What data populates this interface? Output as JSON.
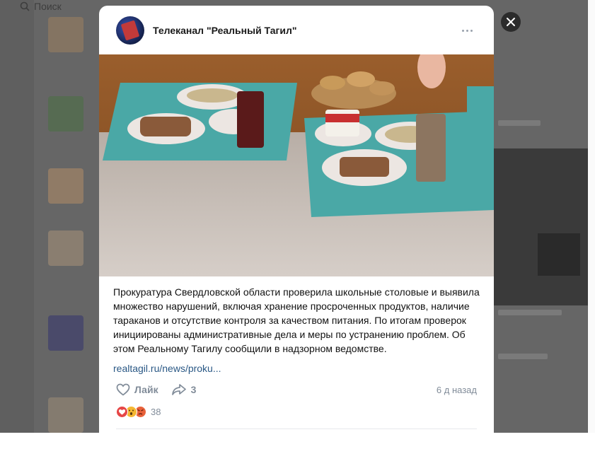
{
  "background": {
    "search_placeholder": "Поиск"
  },
  "post": {
    "channel_name": "Телеканал \"Реальный Тагил\"",
    "text": "Прокуратура Свердловской области проверила школьные столовые и выявила множество нарушений, включая хранение просроченных продуктов, наличие тараканов и отсутствие контроля за качеством питания. По итогам проверок инициированы административные дела и меры по устранению проблем. Об этом Реальному Тагилу сообщили в надзорном ведомстве.",
    "link": "realtagil.ru/news/proku...",
    "like_label": "Лайк",
    "share_count": "3",
    "timestamp": "6 д назад",
    "reactions_count": "38",
    "reaction_icons": [
      "heart-icon",
      "surprised-face-icon",
      "angry-face-icon"
    ],
    "photo_description_icon": "photo-icon"
  },
  "colors": {
    "link": "#2a5885",
    "muted": "#818c99",
    "heart": "#e64646"
  }
}
